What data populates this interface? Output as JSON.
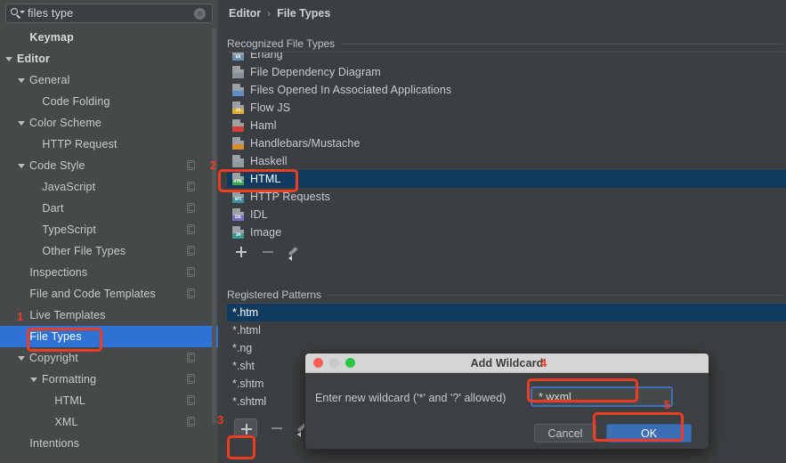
{
  "search": {
    "value": "files type",
    "icon": "search-icon",
    "clear_icon": "clear-icon"
  },
  "sidebar": {
    "items": [
      {
        "label": "Keymap",
        "indent": 1,
        "arrow": "none",
        "bold": true,
        "selected": false,
        "copy": false
      },
      {
        "label": "Editor",
        "indent": 0,
        "arrow": "down",
        "bold": true,
        "selected": false,
        "copy": false
      },
      {
        "label": "General",
        "indent": 1,
        "arrow": "down",
        "bold": false,
        "selected": false,
        "copy": false
      },
      {
        "label": "Code Folding",
        "indent": 2,
        "arrow": "none",
        "bold": false,
        "selected": false,
        "copy": false
      },
      {
        "label": "Color Scheme",
        "indent": 1,
        "arrow": "down",
        "bold": false,
        "selected": false,
        "copy": false
      },
      {
        "label": "HTTP Request",
        "indent": 2,
        "arrow": "none",
        "bold": false,
        "selected": false,
        "copy": false
      },
      {
        "label": "Code Style",
        "indent": 1,
        "arrow": "down",
        "bold": false,
        "selected": false,
        "copy": true
      },
      {
        "label": "JavaScript",
        "indent": 2,
        "arrow": "none",
        "bold": false,
        "selected": false,
        "copy": true
      },
      {
        "label": "Dart",
        "indent": 2,
        "arrow": "none",
        "bold": false,
        "selected": false,
        "copy": true
      },
      {
        "label": "TypeScript",
        "indent": 2,
        "arrow": "none",
        "bold": false,
        "selected": false,
        "copy": true
      },
      {
        "label": "Other File Types",
        "indent": 2,
        "arrow": "none",
        "bold": false,
        "selected": false,
        "copy": true
      },
      {
        "label": "Inspections",
        "indent": 1,
        "arrow": "none",
        "bold": false,
        "selected": false,
        "copy": true
      },
      {
        "label": "File and Code Templates",
        "indent": 1,
        "arrow": "none",
        "bold": false,
        "selected": false,
        "copy": true
      },
      {
        "label": "Live Templates",
        "indent": 1,
        "arrow": "none",
        "bold": false,
        "selected": false,
        "copy": false
      },
      {
        "label": "File Types",
        "indent": 1,
        "arrow": "none",
        "bold": false,
        "selected": true,
        "copy": false
      },
      {
        "label": "Copyright",
        "indent": 1,
        "arrow": "down",
        "bold": false,
        "selected": false,
        "copy": true
      },
      {
        "label": "Formatting",
        "indent": 2,
        "arrow": "down",
        "bold": false,
        "selected": false,
        "copy": true
      },
      {
        "label": "HTML",
        "indent": 3,
        "arrow": "none",
        "bold": false,
        "selected": false,
        "copy": true
      },
      {
        "label": "XML",
        "indent": 3,
        "arrow": "none",
        "bold": false,
        "selected": false,
        "copy": true
      },
      {
        "label": "Intentions",
        "indent": 1,
        "arrow": "none",
        "bold": false,
        "selected": false,
        "copy": false
      }
    ]
  },
  "breadcrumb": {
    "parent": "Editor",
    "separator": "›",
    "current": "File Types"
  },
  "recognized": {
    "title": "Recognized File Types",
    "items": [
      {
        "name": "Erlang",
        "badge": "ER",
        "color": "#6f8fb0",
        "selected": false
      },
      {
        "name": "File Dependency Diagram",
        "badge": "",
        "color": "#8a9299",
        "selected": false
      },
      {
        "name": "Files Opened In Associated Applications",
        "badge": "",
        "color": "#5f8ec4",
        "selected": false
      },
      {
        "name": "Flow JS",
        "badge": "JS",
        "color": "#e0b13a",
        "selected": false
      },
      {
        "name": "Haml",
        "badge": "",
        "color": "#d04038",
        "selected": false
      },
      {
        "name": "Handlebars/Mustache",
        "badge": "",
        "color": "#d98c2a",
        "selected": false
      },
      {
        "name": "Haskell",
        "badge": "",
        "color": "#8f9aa3",
        "selected": false
      },
      {
        "name": "HTML",
        "badge": "HTML",
        "color": "#3fa34d",
        "selected": true
      },
      {
        "name": "HTTP Requests",
        "badge": "API",
        "color": "#3e8f9e",
        "selected": false
      },
      {
        "name": "IDL",
        "badge": "IDL",
        "color": "#7a6fc4",
        "selected": false
      },
      {
        "name": "Image",
        "badge": "IM",
        "color": "#3f9a92",
        "selected": false
      }
    ],
    "toolbar": {
      "add": "add-icon",
      "remove": "remove-icon",
      "edit": "edit-icon"
    }
  },
  "patterns": {
    "title": "Registered Patterns",
    "items": [
      {
        "value": "*.htm",
        "selected": true
      },
      {
        "value": "*.html",
        "selected": false
      },
      {
        "value": "*.ng",
        "selected": false
      },
      {
        "value": "*.sht",
        "selected": false
      },
      {
        "value": "*.shtm",
        "selected": false
      },
      {
        "value": "*.shtml",
        "selected": false
      }
    ],
    "toolbar": {
      "add": "add-icon",
      "remove": "remove-icon",
      "edit": "edit-icon"
    }
  },
  "dialog": {
    "title": "Add Wildcard",
    "label": "Enter new wildcard ('*' and '?' allowed)",
    "input_value": "*.wxml",
    "cancel_label": "Cancel",
    "ok_label": "OK"
  },
  "annotations": {
    "accent_color": "#f03c20",
    "numbers": [
      "1",
      "2",
      "3",
      "4",
      "5"
    ]
  }
}
